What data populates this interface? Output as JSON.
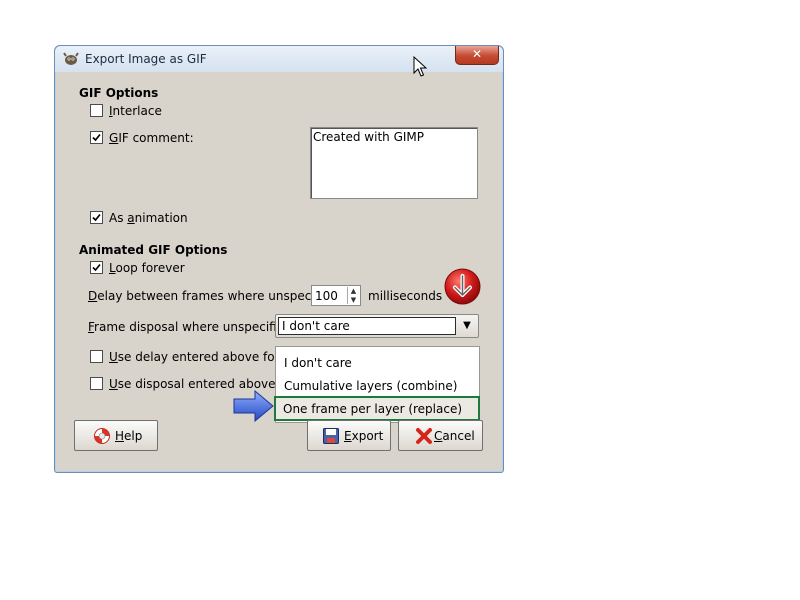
{
  "window": {
    "title": "Export Image as GIF",
    "close_label": "✕"
  },
  "gif_options": {
    "heading": "GIF Options",
    "interlace": {
      "label_u": "I",
      "label_rest": "nterlace",
      "checked": false
    },
    "gif_comment": {
      "label_u": "G",
      "label_rest": "IF comment:",
      "checked": true
    },
    "comment_text": "Created with GIMP",
    "as_animation": {
      "label_pre": "As ",
      "label_u": "a",
      "label_rest": "nimation",
      "checked": true
    }
  },
  "animated_options": {
    "heading": "Animated GIF Options",
    "loop_forever": {
      "label_u": "L",
      "label_rest": "oop forever",
      "checked": true
    },
    "delay_label_u": "D",
    "delay_label_rest": "elay between frames where unspecified:",
    "delay_value": "100",
    "delay_unit": "milliseconds",
    "disposal_label_u": "F",
    "disposal_label_rest": "rame disposal where unspecified:",
    "disposal_selected": "I don't care",
    "use_delay": {
      "label_u": "U",
      "label_rest": "se delay entered above for all f",
      "checked": false
    },
    "use_disposal": {
      "label_u": "U",
      "label_rest": "se disposal entered above for a",
      "checked": false
    }
  },
  "dropdown_options": [
    "I don't care",
    "Cumulative layers (combine)",
    "One frame per layer (replace)"
  ],
  "buttons": {
    "help_u": "H",
    "help_rest": "elp",
    "export_u": "E",
    "export_rest": "xport",
    "cancel_u": "C",
    "cancel_rest": "ancel"
  },
  "colors": {
    "highlight_border": "#1e7a3a",
    "red_arrow": "#d01a1a",
    "blue_arrow": "#2f5fd0"
  }
}
